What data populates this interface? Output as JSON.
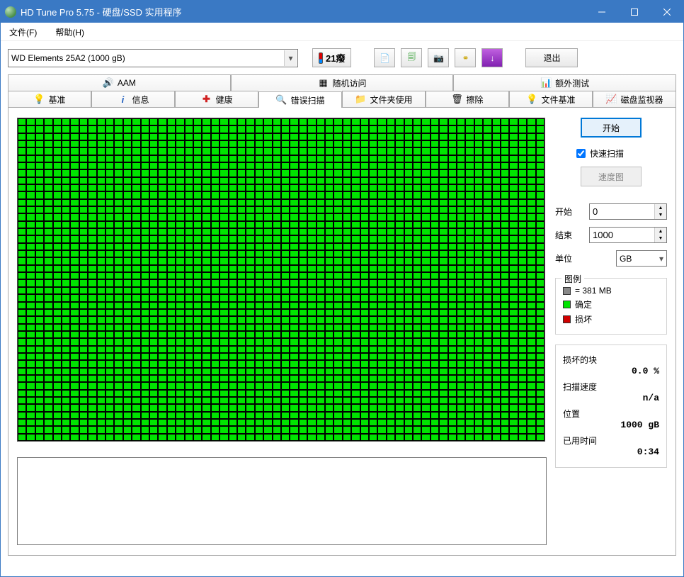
{
  "window": {
    "title": "HD Tune Pro 5.75 - 硬盘/SSD 实用程序"
  },
  "menu": {
    "file": "文件(F)",
    "help": "帮助(H)"
  },
  "toolbar": {
    "drive_selected": "WD      Elements 25A2 (1000 gB)",
    "temperature": "21癈",
    "exit": "退出"
  },
  "tabs_row1": {
    "aam": "AAM",
    "random": "随机访问",
    "extra": "额外测试"
  },
  "tabs_row2": {
    "benchmark": "基准",
    "info": "信息",
    "health": "健康",
    "error_scan": "错误扫描",
    "folder": "文件夹使用",
    "erase": "擦除",
    "file_bench": "文件基准",
    "monitor": "磁盘监视器"
  },
  "scan": {
    "start_btn": "开始",
    "quick_scan": "快速扫描",
    "speed_map_btn": "速度图",
    "start_lbl": "开始",
    "start_val": "0",
    "end_lbl": "结束",
    "end_val": "1000",
    "unit_lbl": "单位",
    "unit_val": "GB"
  },
  "legend": {
    "title": "图例",
    "block_size": "= 381 MB",
    "ok": "确定",
    "bad": "损坏"
  },
  "stats": {
    "bad_blocks_lbl": "损坏的块",
    "bad_blocks_val": "0.0 %",
    "speed_lbl": "扫描速度",
    "speed_val": "n/a",
    "pos_lbl": "位置",
    "pos_val": "1000 gB",
    "time_lbl": "已用时间",
    "time_val": "0:34"
  }
}
